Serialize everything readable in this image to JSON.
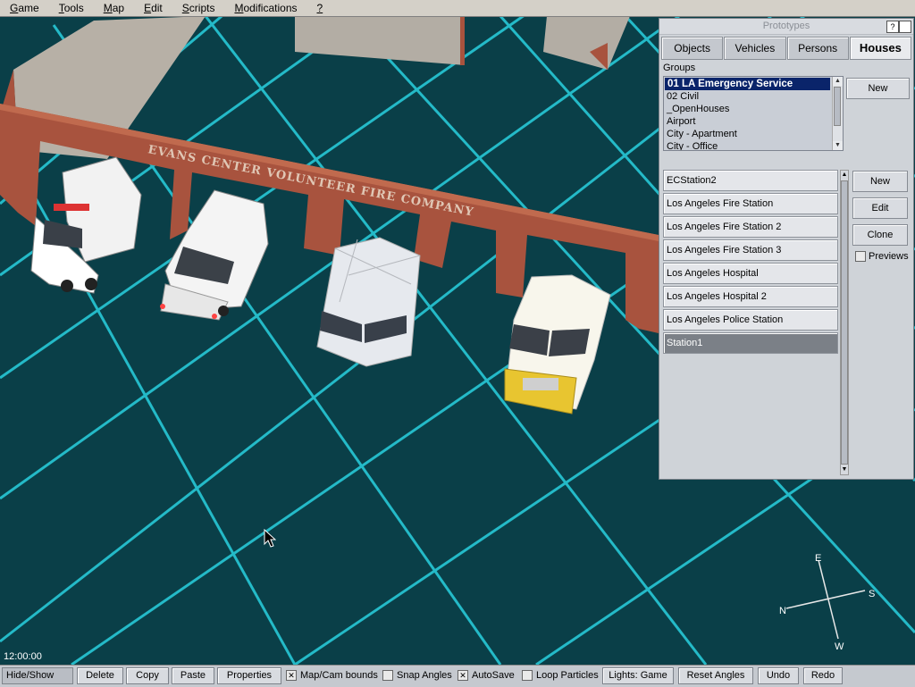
{
  "menu": [
    {
      "label": "Game",
      "u": "G",
      "rest": "ame"
    },
    {
      "label": "Tools",
      "u": "T",
      "rest": "ools"
    },
    {
      "label": "Map",
      "u": "M",
      "rest": "ap"
    },
    {
      "label": "Edit",
      "u": "E",
      "rest": "dit"
    },
    {
      "label": "Scripts",
      "u": "S",
      "rest": "cripts"
    },
    {
      "label": "Modifications",
      "u": "M",
      "rest": "odifications"
    },
    {
      "label": "?",
      "u": "?",
      "rest": ""
    }
  ],
  "scene": {
    "sign_text": "EVANS CENTER VOLUNTEER FIRE COMPANY",
    "colors": {
      "ground": "#0a3f48",
      "grid": "#27c8d6",
      "brick": "#a8533e",
      "wall_top": "#b7b0a6"
    }
  },
  "prototypes": {
    "title": "Prototypes",
    "help": "?",
    "tabs": [
      {
        "label": "Objects",
        "active": false
      },
      {
        "label": "Vehicles",
        "active": false
      },
      {
        "label": "Persons",
        "active": false
      },
      {
        "label": "Houses",
        "active": true
      }
    ],
    "groups_label": "Groups",
    "groups": [
      {
        "label": "01 LA Emergency Service",
        "selected": true
      },
      {
        "label": "02 Civil",
        "selected": false
      },
      {
        "label": "_OpenHouses",
        "selected": false
      },
      {
        "label": "Airport",
        "selected": false
      },
      {
        "label": "City - Apartment",
        "selected": false
      },
      {
        "label": "City - Office",
        "selected": false
      }
    ],
    "groups_new": "New",
    "items": [
      {
        "label": "ECStation2",
        "selected": false
      },
      {
        "label": "Los Angeles Fire Station",
        "selected": false
      },
      {
        "label": "Los Angeles Fire Station 2",
        "selected": false
      },
      {
        "label": "Los Angeles Fire Station 3",
        "selected": false
      },
      {
        "label": "Los Angeles Hospital",
        "selected": false
      },
      {
        "label": "Los Angeles Hospital 2",
        "selected": false
      },
      {
        "label": "Los Angeles Police Station",
        "selected": false
      },
      {
        "label": "Station1",
        "selected": true
      }
    ],
    "actions": {
      "new": "New",
      "edit": "Edit",
      "clone": "Clone"
    },
    "previews": {
      "label": "Previews",
      "checked": false
    }
  },
  "clock": "12:00:00",
  "compass": {
    "n": "N",
    "e": "E",
    "s": "S",
    "w": "W"
  },
  "toolbar": {
    "hide_show": "Hide/Show",
    "delete": "Delete",
    "copy": "Copy",
    "paste": "Paste",
    "properties": "Properties",
    "map_cam_bounds": {
      "label": "Map/Cam bounds",
      "checked": true
    },
    "snap_angles": {
      "label": "Snap Angles",
      "checked": false
    },
    "autosave": {
      "label": "AutoSave",
      "checked": true
    },
    "loop_particles": {
      "label": "Loop Particles",
      "checked": false
    },
    "lights": "Lights: Game",
    "reset_angles": "Reset Angles",
    "undo": "Undo",
    "redo": "Redo"
  }
}
